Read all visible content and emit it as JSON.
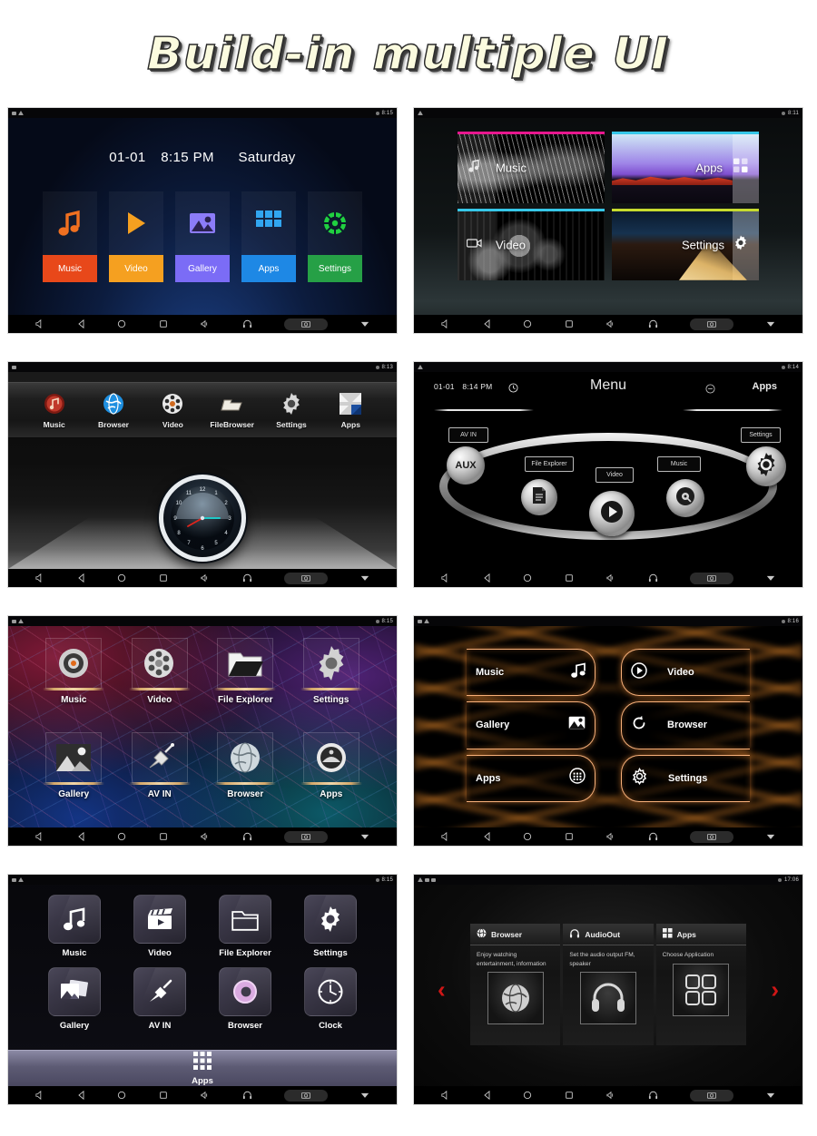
{
  "header": {
    "title": "Build-in multiple UI"
  },
  "nav_bar": {
    "items": [
      {
        "name": "volume-down-icon",
        "glyph": "volume-down"
      },
      {
        "name": "back-icon",
        "glyph": "back"
      },
      {
        "name": "home-icon",
        "glyph": "home"
      },
      {
        "name": "recents-icon",
        "glyph": "recents"
      },
      {
        "name": "volume-up-icon",
        "glyph": "volume-up"
      },
      {
        "name": "headphones-icon",
        "glyph": "headphones"
      },
      {
        "name": "screenshot-icon",
        "glyph": "camera"
      },
      {
        "name": "collapse-icon",
        "glyph": "chevron-down"
      }
    ]
  },
  "colors": {
    "music": "#E8481A",
    "video": "#F5A020",
    "gallery": "#7B6CF6",
    "apps": "#1E88E5",
    "settings": "#26A046",
    "neon_orange": "#F7B07A",
    "arrow_red": "#D01616",
    "title_fill": "#FBFBDF"
  },
  "panels": [
    {
      "id": "panel-1-tile-launcher",
      "status_time": "8:15",
      "clock": {
        "date": "01-01",
        "time": "8:15 PM",
        "weekday": "Saturday"
      },
      "tiles": [
        {
          "label": "Music",
          "icon": "music-note-icon",
          "color": "#E8481A"
        },
        {
          "label": "Video",
          "icon": "play-icon",
          "color": "#F5A020"
        },
        {
          "label": "Gallery",
          "icon": "photo-icon",
          "color": "#7B6CF6"
        },
        {
          "label": "Apps",
          "icon": "apps-grid-icon",
          "color": "#1E88E5"
        },
        {
          "label": "Settings",
          "icon": "gear-icon",
          "color": "#26A046"
        }
      ]
    },
    {
      "id": "panel-2-photo-tiles",
      "status_time": "8:11",
      "tiles": [
        {
          "label": "Music",
          "accent": "#E8178F",
          "icon": "music-note-icon",
          "photo": "guitar"
        },
        {
          "label": "Apps",
          "accent": "#36C7E8",
          "icon": "apps-grid-icon",
          "photo": "sunset"
        },
        {
          "label": "Video",
          "accent": "#36C7E8",
          "icon": "video-cam-icon",
          "photo": "camera-gear"
        },
        {
          "label": "Settings",
          "accent": "#C6DB2E",
          "icon": "gear-icon",
          "photo": "road"
        }
      ]
    },
    {
      "id": "panel-3-metal-clock",
      "status_time": "8:13",
      "items": [
        {
          "label": "Music",
          "icon": "music-disc-icon"
        },
        {
          "label": "Browser",
          "icon": "globe-icon"
        },
        {
          "label": "Video",
          "icon": "film-reel-icon"
        },
        {
          "label": "FileBrowser",
          "icon": "folder-icon"
        },
        {
          "label": "Settings",
          "icon": "gear-icon"
        },
        {
          "label": "Apps",
          "icon": "apps-arrows-icon"
        }
      ],
      "clock_numerals": [
        "12",
        "1",
        "2",
        "3",
        "4",
        "5",
        "6",
        "7",
        "8",
        "9",
        "10",
        "11"
      ]
    },
    {
      "id": "panel-4-ellipse-menu",
      "status_time": "8:14",
      "header": {
        "date": "01-01",
        "time": "8:14 PM",
        "title": "Menu",
        "right_label": "Apps",
        "clock_icon": "clock-icon",
        "apps_icon": "circle-minus-icon"
      },
      "plates": [
        "AV IN",
        "File Explorer",
        "Video",
        "Music",
        "Settings"
      ],
      "knobs": [
        {
          "label": "AUX",
          "icon": "aux-text-icon"
        },
        {
          "label": "",
          "icon": "document-icon"
        },
        {
          "label": "",
          "icon": "play-icon"
        },
        {
          "label": "",
          "icon": "vinyl-icon"
        },
        {
          "label": "",
          "icon": "gear-icon"
        }
      ]
    },
    {
      "id": "panel-5-neon-grid",
      "status_time": "8:15",
      "items": [
        {
          "label": "Music",
          "icon": "music-disc-icon"
        },
        {
          "label": "Video",
          "icon": "film-reel-icon"
        },
        {
          "label": "File Explorer",
          "icon": "folder-icon"
        },
        {
          "label": "Settings",
          "icon": "gear-icon"
        },
        {
          "label": "Gallery",
          "icon": "photo-icon"
        },
        {
          "label": "AV IN",
          "icon": "rca-plug-icon"
        },
        {
          "label": "Browser",
          "icon": "globe-icon"
        },
        {
          "label": "Apps",
          "icon": "apps-circle-icon"
        }
      ]
    },
    {
      "id": "panel-6-orange-rays",
      "status_time": "8:16",
      "left_items": [
        {
          "label": "Music",
          "icon": "music-note-icon"
        },
        {
          "label": "Gallery",
          "icon": "photo-icon"
        },
        {
          "label": "Apps",
          "icon": "apps-circle-icon"
        }
      ],
      "right_items": [
        {
          "label": "Video",
          "icon": "play-circle-icon"
        },
        {
          "label": "Browser",
          "icon": "refresh-icon"
        },
        {
          "label": "Settings",
          "icon": "gear-icon"
        }
      ]
    },
    {
      "id": "panel-7-dark-tiles",
      "status_time": "8:15",
      "items": [
        {
          "label": "Music",
          "icon": "music-note-icon"
        },
        {
          "label": "Video",
          "icon": "clapperboard-icon"
        },
        {
          "label": "File Explorer",
          "icon": "folder-icon"
        },
        {
          "label": "Settings",
          "icon": "gear-icon"
        },
        {
          "label": "Gallery",
          "icon": "photo-icon"
        },
        {
          "label": "AV IN",
          "icon": "rca-plug-icon"
        },
        {
          "label": "Browser",
          "icon": "browser-ring-icon"
        },
        {
          "label": "Clock",
          "icon": "clock-icon"
        }
      ],
      "dock": {
        "label": "Apps",
        "icon": "apps-grid-icon"
      }
    },
    {
      "id": "panel-8-card-carousel",
      "status_time": "17:06",
      "prev_arrow": "‹",
      "next_arrow": "›",
      "cards": [
        {
          "title": "Browser",
          "icon": "globe-icon",
          "desc": "Enjoy watching entertainment, information",
          "thumb": "globe-thumb-icon"
        },
        {
          "title": "AudioOut",
          "icon": "headphones-icon",
          "desc": "Set the audio output FM, speaker",
          "thumb": "headphones-thumb-icon"
        },
        {
          "title": "Apps",
          "icon": "apps-grid-icon",
          "desc": "Choose Application",
          "thumb": "apps-thumb-icon"
        }
      ]
    }
  ]
}
